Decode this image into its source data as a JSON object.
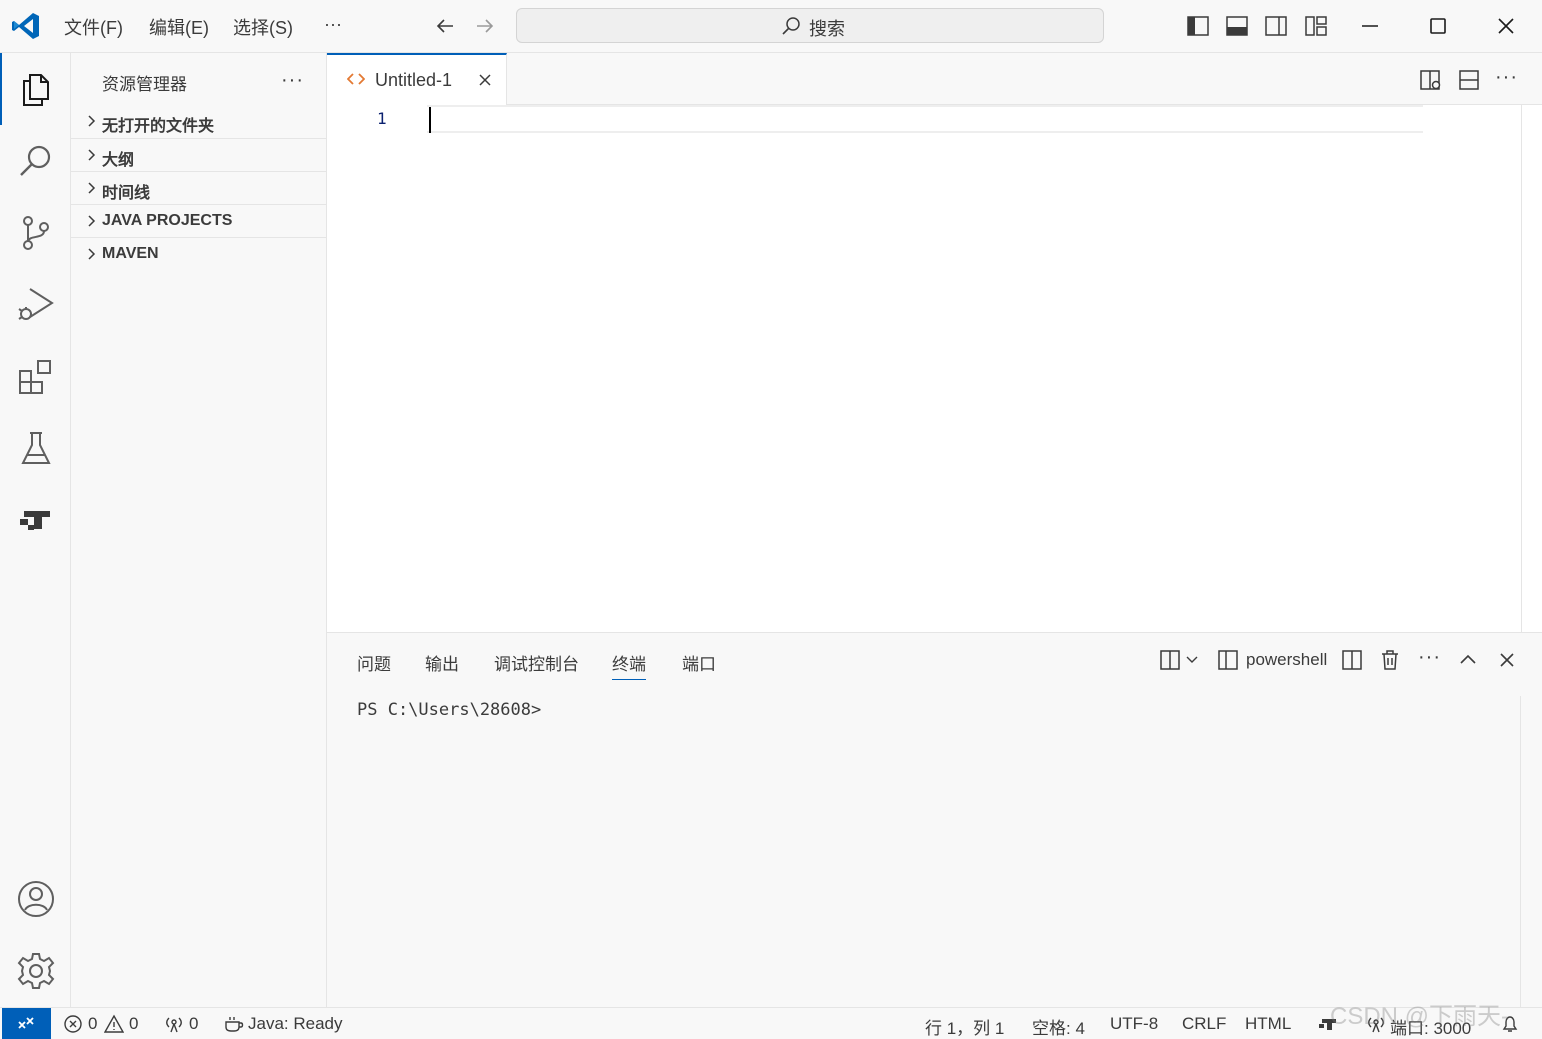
{
  "titlebar": {
    "menu": [
      "文件(F)",
      "编辑(E)",
      "选择(S)",
      "···"
    ],
    "search_placeholder": "搜索"
  },
  "sidebar": {
    "title": "资源管理器",
    "more": "···",
    "sections": [
      "无打开的文件夹",
      "大纲",
      "时间线",
      "JAVA PROJECTS",
      "MAVEN"
    ]
  },
  "editor": {
    "tab_label": "Untitled-1",
    "line_number": "1",
    "more": "···"
  },
  "panel": {
    "tabs": [
      "问题",
      "输出",
      "调试控制台",
      "终端",
      "端口"
    ],
    "active_tab": "终端",
    "shell": "powershell",
    "more": "···",
    "terminal_prompt": "PS C:\\Users\\28608>"
  },
  "statusbar": {
    "errors": "0",
    "warnings": "0",
    "ports_forwarded": "0",
    "java_status": "Java: Ready",
    "cursor_position": "行 1，列 1",
    "indent": "空格: 4",
    "encoding": "UTF-8",
    "eol": "CRLF",
    "language": "HTML",
    "port": "端口: 3000"
  },
  "watermark": "CSDN @下雨天-",
  "colors": {
    "accent": "#005fb8",
    "logo": "#0066b8",
    "line_number": "#0b216f"
  }
}
